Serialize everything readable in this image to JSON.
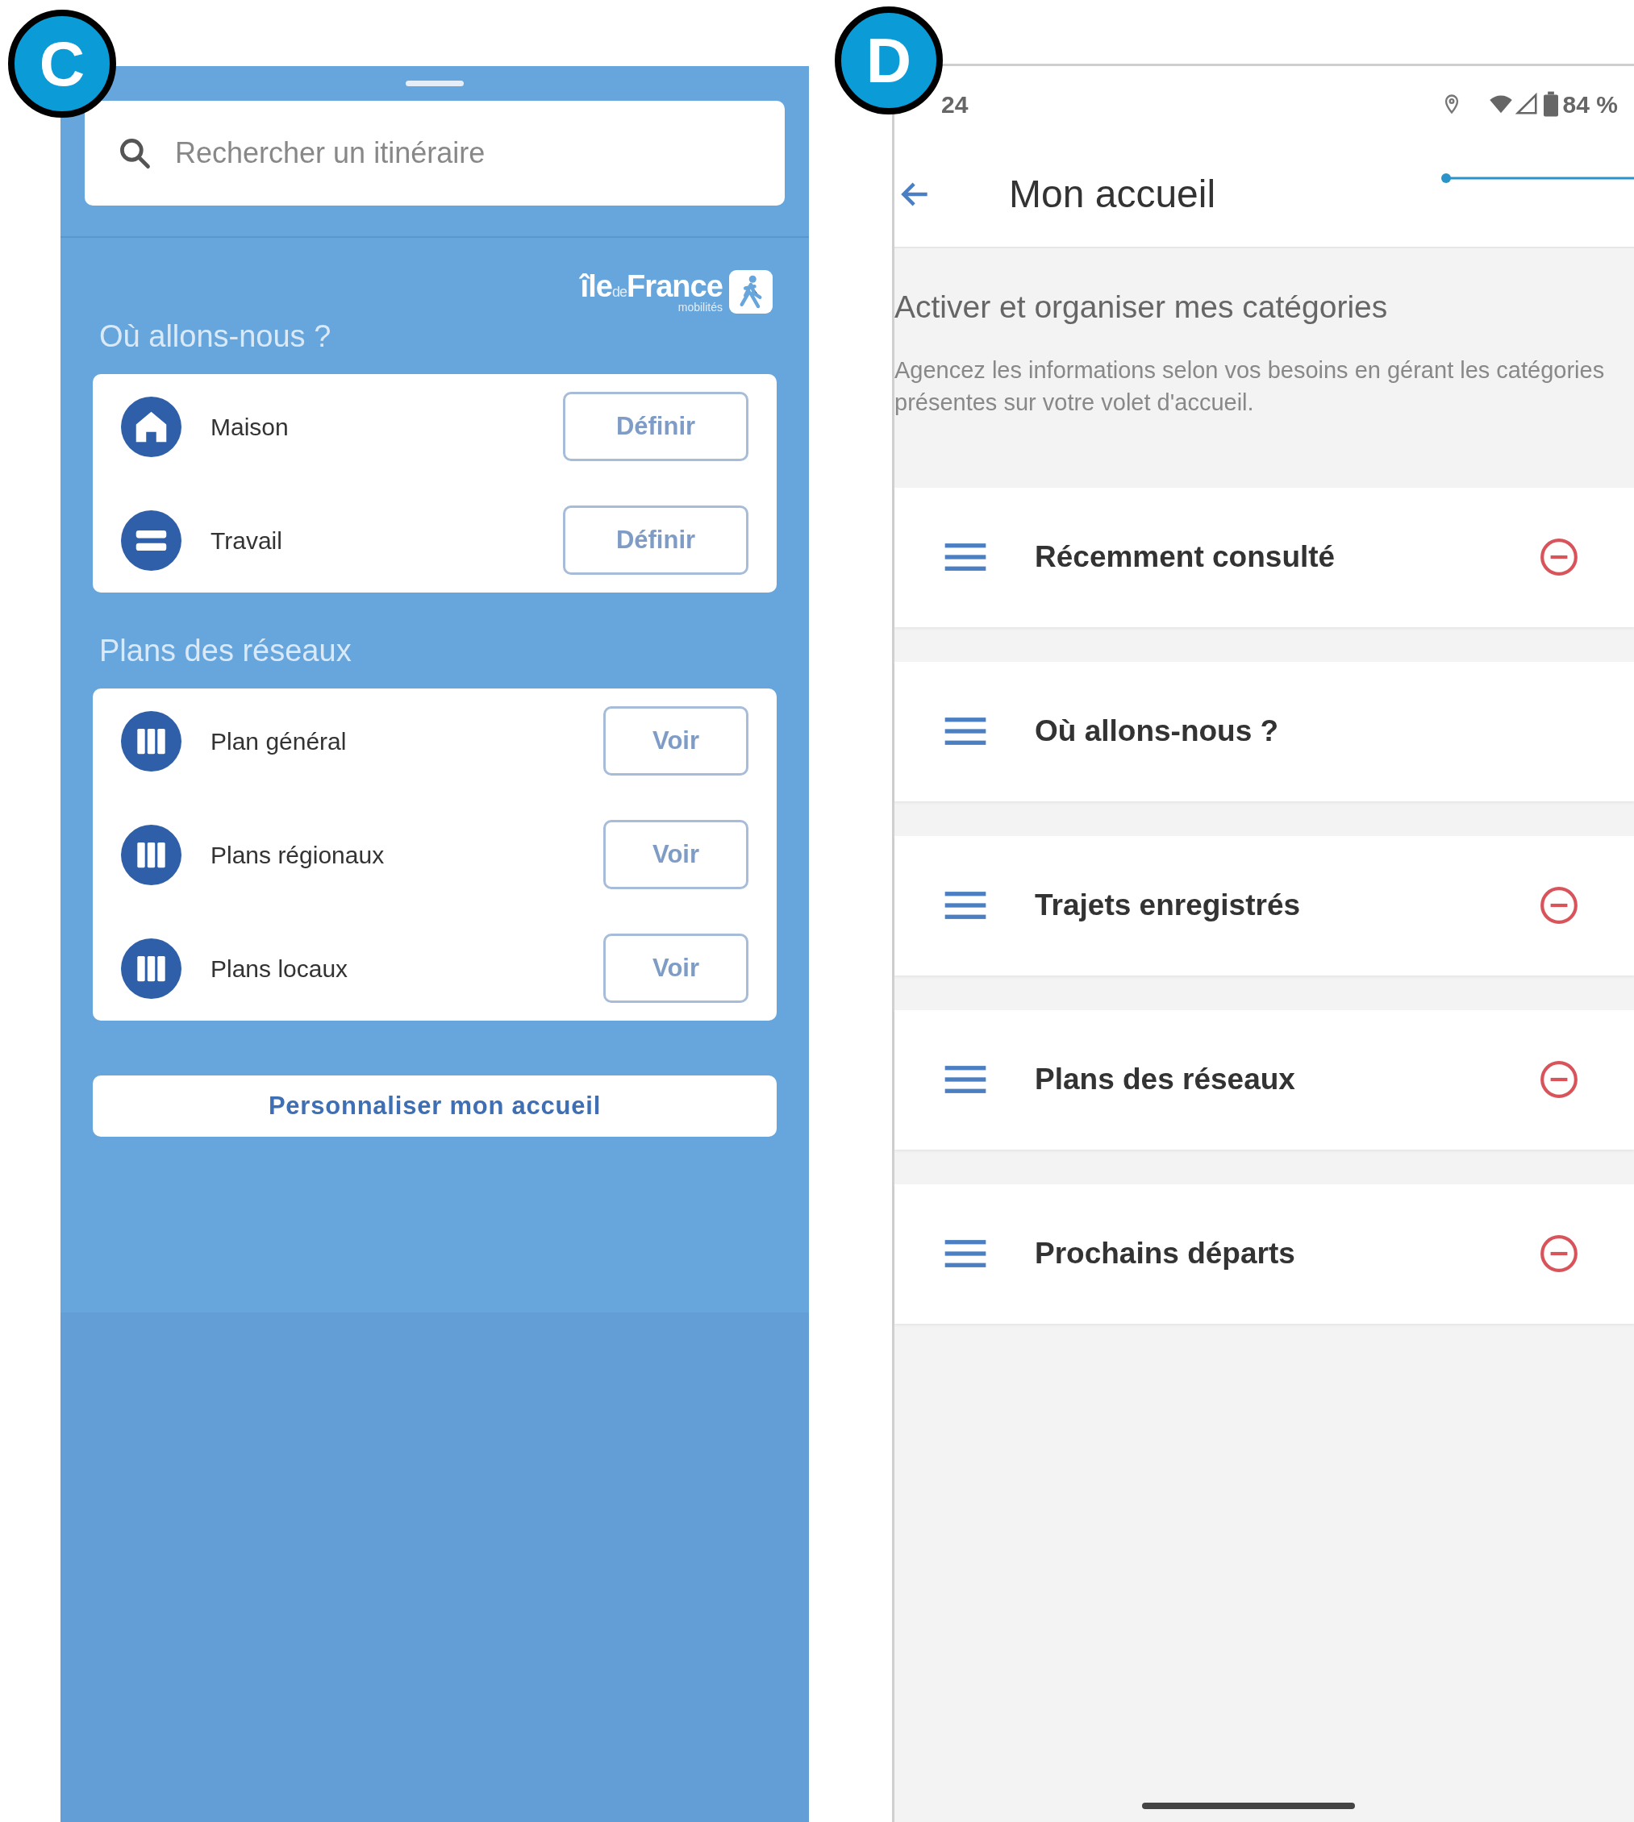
{
  "panel_c": {
    "badge": "C",
    "search": {
      "placeholder": "Rechercher un itinéraire"
    },
    "logo": {
      "words": [
        "île",
        "de",
        "France"
      ],
      "tagline": "mobilités"
    },
    "places": {
      "title": "Où allons-nous ?",
      "items": [
        {
          "kind": "home",
          "label": "Maison",
          "action": "Définir"
        },
        {
          "kind": "work",
          "label": "Travail",
          "action": "Définir"
        }
      ]
    },
    "maps": {
      "title": "Plans des réseaux",
      "items": [
        {
          "kind": "map",
          "label": "Plan général",
          "action": "Voir"
        },
        {
          "kind": "map",
          "label": "Plans régionaux",
          "action": "Voir"
        },
        {
          "kind": "map",
          "label": "Plans locaux",
          "action": "Voir"
        }
      ]
    },
    "customize_button": "Personnaliser mon accueil"
  },
  "panel_d": {
    "badge": "D",
    "status_bar": {
      "time": "24",
      "battery": "84 %"
    },
    "title": "Mon accueil",
    "section_title": "Activer et organiser mes catégories",
    "description": "Agencez les informations selon vos besoins en gérant les catégories présentes sur votre volet d'accueil.",
    "categories": [
      {
        "label": "Récemment consulté",
        "removable": true
      },
      {
        "label": "Où allons-nous ?",
        "removable": false
      },
      {
        "label": "Trajets enregistrés",
        "removable": true
      },
      {
        "label": "Plans des réseaux",
        "removable": true
      },
      {
        "label": "Prochains départs",
        "removable": true
      }
    ]
  }
}
